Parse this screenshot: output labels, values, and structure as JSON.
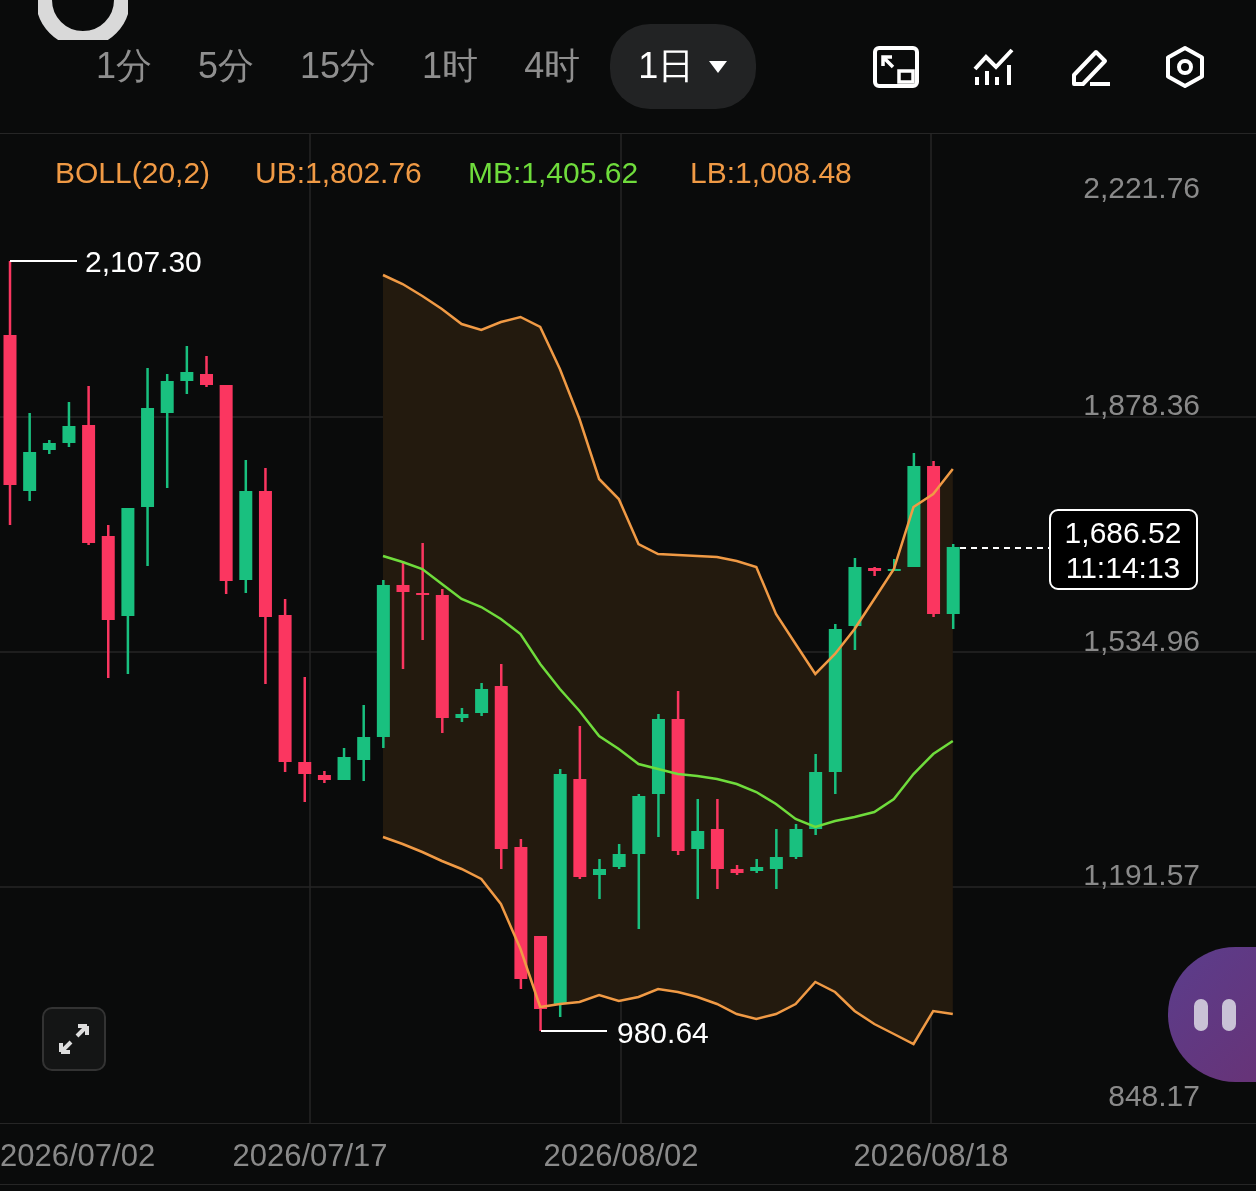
{
  "tabs": [
    {
      "label": "1分",
      "selected": false,
      "dropdown": false
    },
    {
      "label": "5分",
      "selected": false,
      "dropdown": false
    },
    {
      "label": "15分",
      "selected": false,
      "dropdown": false
    },
    {
      "label": "1时",
      "selected": false,
      "dropdown": false
    },
    {
      "label": "4时",
      "selected": false,
      "dropdown": false
    },
    {
      "label": "1日",
      "selected": true,
      "dropdown": true
    }
  ],
  "chart": {
    "legend": [
      {
        "text": "BOLL(20,2)",
        "color": "#f09a45"
      },
      {
        "text": "UB:1,802.76",
        "color": "#f09a45"
      },
      {
        "text": "MB:1,405.62",
        "color": "#6fdc3c"
      },
      {
        "text": "LB:1,008.48",
        "color": "#f09a45"
      }
    ],
    "y_labels": [
      "2,221.76",
      "1,878.36",
      "1,534.96",
      "1,191.57",
      "848.17"
    ],
    "high_marker": "2,107.30",
    "low_marker": "980.64",
    "price_tag": {
      "price": "1,686.52",
      "countdown": "11:14:13"
    },
    "x_labels": [
      "2026/07/02",
      "2026/07/17",
      "2026/08/02",
      "2026/08/18"
    ]
  }
}
